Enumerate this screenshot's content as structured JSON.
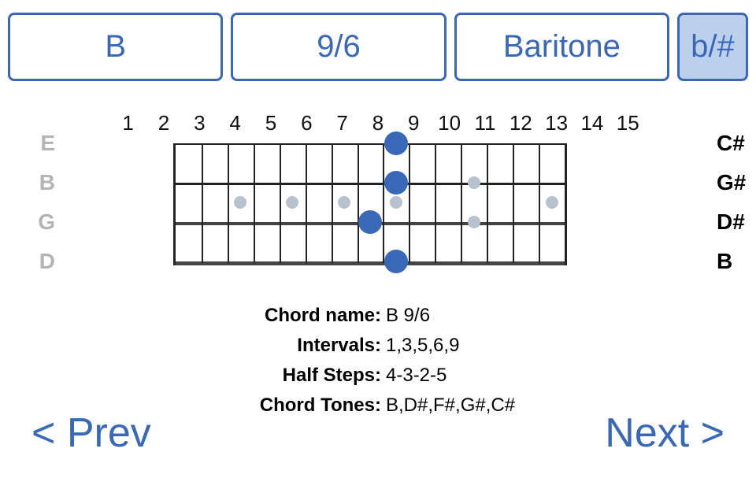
{
  "controls": {
    "root": "B",
    "chord_type": "9/6",
    "tuning": "Baritone",
    "accidental": "b/#"
  },
  "fretboard": {
    "fret_count": 15,
    "fret_labels": [
      "1",
      "2",
      "3",
      "4",
      "5",
      "6",
      "7",
      "8",
      "9",
      "10",
      "11",
      "12",
      "13",
      "14",
      "15"
    ],
    "open_strings": [
      "E",
      "B",
      "G",
      "D"
    ],
    "fretted_notes": [
      "C#",
      "G#",
      "D#",
      "B"
    ],
    "inlay_frets_single": [
      3,
      5,
      7,
      9,
      15
    ],
    "inlay_frets_double": [
      12
    ],
    "dots": [
      {
        "string": 0,
        "fret": 9
      },
      {
        "string": 1,
        "fret": 9
      },
      {
        "string": 2,
        "fret": 8
      },
      {
        "string": 3,
        "fret": 9
      }
    ]
  },
  "info": {
    "chord_name_label": "Chord name:",
    "chord_name": "B 9/6",
    "intervals_label": "Intervals:",
    "intervals": "1,3,5,6,9",
    "half_steps_label": "Half Steps:",
    "half_steps": "4-3-2-5",
    "chord_tones_label": "Chord Tones:",
    "chord_tones": "B,D#,F#,G#,C#"
  },
  "nav": {
    "prev": "< Prev",
    "next": "Next >"
  },
  "chart_data": {
    "type": "fretboard",
    "title": "B 9/6 (Baritone tuning)",
    "strings": [
      {
        "open": "E",
        "fretted": "C#"
      },
      {
        "open": "B",
        "fretted": "G#"
      },
      {
        "open": "G",
        "fretted": "D#"
      },
      {
        "open": "D",
        "fretted": "B"
      }
    ],
    "frets_shown": [
      1,
      15
    ],
    "fingering": [
      {
        "string": 1,
        "fret": 9,
        "note": "C#"
      },
      {
        "string": 2,
        "fret": 9,
        "note": "G#"
      },
      {
        "string": 3,
        "fret": 8,
        "note": "D#"
      },
      {
        "string": 4,
        "fret": 9,
        "note": "B"
      }
    ],
    "chord_tones": [
      "B",
      "D#",
      "F#",
      "G#",
      "C#"
    ],
    "intervals": [
      "1",
      "3",
      "5",
      "6",
      "9"
    ],
    "half_steps": [
      4,
      3,
      2,
      5
    ]
  }
}
